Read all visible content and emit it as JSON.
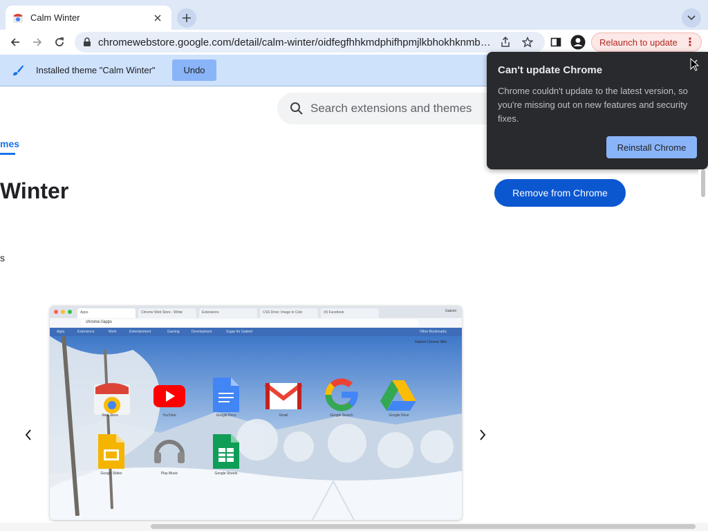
{
  "tab": {
    "title": "Calm Winter",
    "favicon": "chrome-web-store-icon",
    "close_icon": "close-icon"
  },
  "toolbar": {
    "url": "chromewebstore.google.com/detail/calm-winter/oidfegfhhkmdphifhpmjlkbhokhknmb…",
    "relaunch_label": "Relaunch to update"
  },
  "infobar": {
    "message": "Installed theme \"Calm Winter\"",
    "undo_label": "Undo"
  },
  "page": {
    "search_placeholder": "Search extensions and themes",
    "nav_link": "mes",
    "title": "Winter",
    "partial_text": "s",
    "remove_button": "Remove from Chrome"
  },
  "preview": {
    "user": "Gabriel",
    "url": "chrome://apps",
    "tabs": [
      "Apps",
      "Chrome Web Store - Winte",
      "Extensions",
      "CSS Drive: Image to Colo",
      "(4) Facebook"
    ],
    "bookmarks": [
      "Apps",
      "Extensions",
      "Work",
      "Entertainment",
      "Gaming",
      "Development",
      "Sugar for Gabriel",
      "Other Bookmarks"
    ],
    "profile_name": "Gabriel Chrome Wiki",
    "apps": [
      "Web Store",
      "YouTube",
      "Google Docs",
      "Gmail",
      "Google Search",
      "Google Drive",
      "Google Slides",
      "Play Music",
      "Google Sheets"
    ]
  },
  "popup": {
    "title": "Can't update Chrome",
    "body": "Chrome couldn't update to the latest version, so you're missing out on new features and security fixes.",
    "button": "Reinstall Chrome"
  },
  "colors": {
    "accent": "#0b57d0",
    "popup_bg": "#292a2d",
    "infobar_bg": "#cfe2fc",
    "relaunch_text": "#b3261e"
  }
}
